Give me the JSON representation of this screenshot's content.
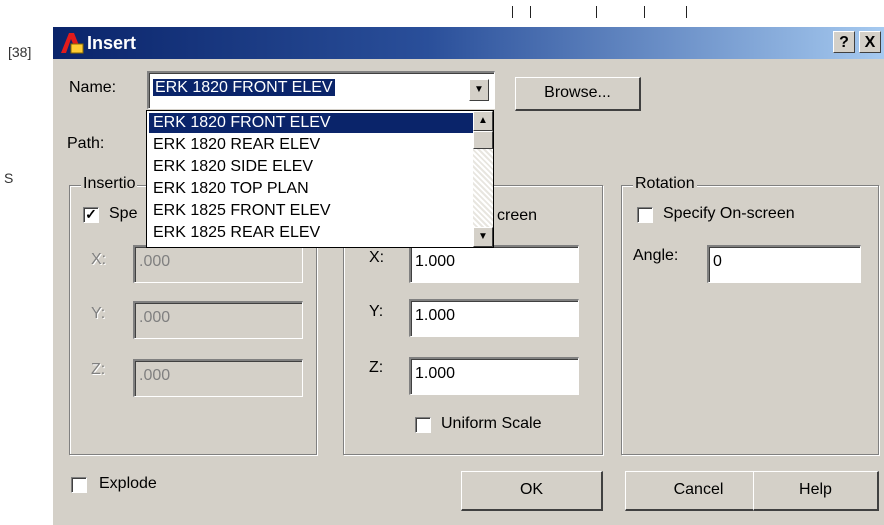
{
  "background": {
    "ref_label": "[38]",
    "side_label": "S"
  },
  "dialog": {
    "title": "Insert",
    "help_btn": "?",
    "close_btn": "X"
  },
  "name": {
    "label": "Name:",
    "value": "ERK 1820 FRONT ELEV",
    "browse_label": "Browse...",
    "options": [
      "ERK 1820 FRONT ELEV",
      "ERK 1820 REAR ELEV",
      "ERK 1820 SIDE ELEV",
      "ERK 1820 TOP PLAN",
      "ERK 1825 FRONT ELEV",
      "ERK 1825 REAR ELEV"
    ]
  },
  "path": {
    "label": "Path:"
  },
  "insertion": {
    "title": "Insertio",
    "specify_label": "Spe",
    "specify_checked": true,
    "x_label": "X:",
    "x_value": ".000",
    "y_label": "Y:",
    "y_value": ".000",
    "z_label": "Z:",
    "z_value": ".000"
  },
  "scale": {
    "specify_label": "creen",
    "x_label": "X:",
    "x_value": "1.000",
    "y_label": "Y:",
    "y_value": "1.000",
    "z_label": "Z:",
    "z_value": "1.000",
    "uniform_label": "Uniform Scale",
    "uniform_checked": false
  },
  "rotation": {
    "title": "Rotation",
    "specify_label": "Specify On-screen",
    "specify_checked": false,
    "angle_label": "Angle:",
    "angle_value": "0"
  },
  "explode": {
    "label": "Explode",
    "checked": false
  },
  "buttons": {
    "ok": "OK",
    "cancel": "Cancel",
    "help": "Help"
  },
  "colors": {
    "title_start": "#0a246a",
    "title_end": "#a6caf0",
    "dialog_face": "#d4d0c8",
    "selection": "#0a246a"
  }
}
